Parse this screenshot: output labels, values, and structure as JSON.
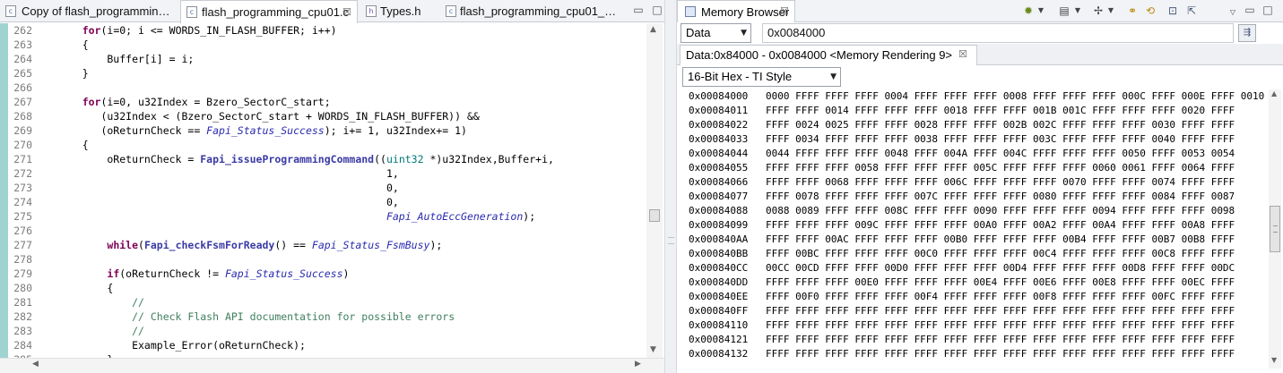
{
  "editor": {
    "tabs": [
      {
        "label": "Copy of flash_programmin…",
        "icon": "c-file-icon",
        "active": false
      },
      {
        "label": "flash_programming_cpu01.c",
        "icon": "c-file-icon",
        "active": true
      },
      {
        "label": "Types.h",
        "icon": "h-file-icon",
        "active": false
      },
      {
        "label": "flash_programming_cpu01_…",
        "icon": "c-file-icon",
        "active": false
      }
    ],
    "lines": [
      {
        "n": "262",
        "segs": [
          {
            "t": "    "
          },
          {
            "t": "for",
            "c": "kw"
          },
          {
            "t": "(i=0; i <= WORDS_IN_FLASH_BUFFER; i++)"
          }
        ]
      },
      {
        "n": "263",
        "segs": [
          {
            "t": "    {"
          }
        ]
      },
      {
        "n": "264",
        "segs": [
          {
            "t": "        Buffer[i] = i;"
          }
        ]
      },
      {
        "n": "265",
        "segs": [
          {
            "t": "    }"
          }
        ]
      },
      {
        "n": "266",
        "segs": []
      },
      {
        "n": "267",
        "segs": [
          {
            "t": "    "
          },
          {
            "t": "for",
            "c": "kw"
          },
          {
            "t": "(i=0, u32Index = Bzero_SectorC_start;"
          }
        ]
      },
      {
        "n": "268",
        "segs": [
          {
            "t": "       (u32Index < (Bzero_SectorC_start + WORDS_IN_FLASH_BUFFER)) &&"
          }
        ]
      },
      {
        "n": "269",
        "segs": [
          {
            "t": "       (oReturnCheck == "
          },
          {
            "t": "Fapi_Status_Success",
            "c": "it"
          },
          {
            "t": "); i+= 1, u32Index+= 1)"
          }
        ]
      },
      {
        "n": "270",
        "segs": [
          {
            "t": "    {"
          }
        ]
      },
      {
        "n": "271",
        "segs": [
          {
            "t": "        oReturnCheck = "
          },
          {
            "t": "Fapi_issueProgrammingCommand",
            "c": "fn"
          },
          {
            "t": "(("
          },
          {
            "t": "uint32",
            "c": "tp"
          },
          {
            "t": " *)u32Index,Buffer+i,"
          }
        ]
      },
      {
        "n": "272",
        "segs": [
          {
            "t": "                                                     1,"
          }
        ]
      },
      {
        "n": "273",
        "segs": [
          {
            "t": "                                                     0,"
          }
        ]
      },
      {
        "n": "274",
        "segs": [
          {
            "t": "                                                     0,"
          }
        ]
      },
      {
        "n": "275",
        "segs": [
          {
            "t": "                                                     "
          },
          {
            "t": "Fapi_AutoEccGeneration",
            "c": "it"
          },
          {
            "t": ");"
          }
        ]
      },
      {
        "n": "276",
        "segs": []
      },
      {
        "n": "277",
        "segs": [
          {
            "t": "        "
          },
          {
            "t": "while",
            "c": "kw"
          },
          {
            "t": "("
          },
          {
            "t": "Fapi_checkFsmForReady",
            "c": "fn"
          },
          {
            "t": "() == "
          },
          {
            "t": "Fapi_Status_FsmBusy",
            "c": "it"
          },
          {
            "t": ");"
          }
        ]
      },
      {
        "n": "278",
        "segs": []
      },
      {
        "n": "279",
        "segs": [
          {
            "t": "        "
          },
          {
            "t": "if",
            "c": "kw"
          },
          {
            "t": "(oReturnCheck != "
          },
          {
            "t": "Fapi_Status_Success",
            "c": "it"
          },
          {
            "t": ")"
          }
        ]
      },
      {
        "n": "280",
        "segs": [
          {
            "t": "        {"
          }
        ]
      },
      {
        "n": "281",
        "segs": [
          {
            "t": "            "
          },
          {
            "t": "//",
            "c": "cm"
          }
        ]
      },
      {
        "n": "282",
        "segs": [
          {
            "t": "            "
          },
          {
            "t": "// Check Flash API documentation for possible errors",
            "c": "cm"
          }
        ]
      },
      {
        "n": "283",
        "segs": [
          {
            "t": "            "
          },
          {
            "t": "//",
            "c": "cm"
          }
        ]
      },
      {
        "n": "284",
        "segs": [
          {
            "t": "            Example_Error(oReturnCheck);"
          }
        ]
      },
      {
        "n": "285",
        "segs": [
          {
            "t": "        }"
          }
        ]
      }
    ]
  },
  "memory_browser": {
    "title": "Memory Browser",
    "memory_space": "Data",
    "address_input": "0x0084000",
    "rendering_tab": "Data:0x84000 - 0x0084000 <Memory Rendering 9>",
    "format": "16-Bit Hex - TI Style",
    "rows": [
      {
        "addr": "0x00084000",
        "data": "0000 FFFF FFFF FFFF 0004 FFFF FFFF FFFF 0008 FFFF FFFF FFFF 000C FFFF 000E FFFF 0010"
      },
      {
        "addr": "0x00084011",
        "data": "FFFF FFFF 0014 FFFF FFFF FFFF 0018 FFFF FFFF 001B 001C FFFF FFFF FFFF 0020 FFFF"
      },
      {
        "addr": "0x00084022",
        "data": "FFFF 0024 0025 FFFF FFFF 0028 FFFF FFFF 002B 002C FFFF FFFF FFFF 0030 FFFF FFFF"
      },
      {
        "addr": "0x00084033",
        "data": "FFFF 0034 FFFF FFFF FFFF 0038 FFFF FFFF FFFF 003C FFFF FFFF FFFF 0040 FFFF FFFF"
      },
      {
        "addr": "0x00084044",
        "data": "0044 FFFF FFFF FFFF 0048 FFFF 004A FFFF 004C FFFF FFFF FFFF 0050 FFFF 0053 0054"
      },
      {
        "addr": "0x00084055",
        "data": "FFFF FFFF FFFF 0058 FFFF FFFF FFFF 005C FFFF FFFF FFFF 0060 0061 FFFF 0064 FFFF"
      },
      {
        "addr": "0x00084066",
        "data": "FFFF FFFF 0068 FFFF FFFF FFFF 006C FFFF FFFF FFFF 0070 FFFF FFFF 0074 FFFF FFFF"
      },
      {
        "addr": "0x00084077",
        "data": "FFFF 0078 FFFF FFFF FFFF 007C FFFF FFFF FFFF 0080 FFFF FFFF FFFF 0084 FFFF 0087"
      },
      {
        "addr": "0x00084088",
        "data": "0088 0089 FFFF FFFF 008C FFFF FFFF 0090 FFFF FFFF FFFF 0094 FFFF FFFF FFFF 0098"
      },
      {
        "addr": "0x00084099",
        "data": "FFFF FFFF FFFF 009C FFFF FFFF FFFF 00A0 FFFF 00A2 FFFF 00A4 FFFF FFFF 00A8 FFFF"
      },
      {
        "addr": "0x000840AA",
        "data": "FFFF FFFF 00AC FFFF FFFF FFFF 00B0 FFFF FFFF FFFF 00B4 FFFF FFFF 00B7 00B8 FFFF"
      },
      {
        "addr": "0x000840BB",
        "data": "FFFF 00BC FFFF FFFF FFFF 00C0 FFFF FFFF FFFF 00C4 FFFF FFFF FFFF 00C8 FFFF FFFF"
      },
      {
        "addr": "0x000840CC",
        "data": "00CC 00CD FFFF FFFF 00D0 FFFF FFFF FFFF 00D4 FFFF FFFF FFFF 00D8 FFFF FFFF 00DC"
      },
      {
        "addr": "0x000840DD",
        "data": "FFFF FFFF FFFF 00E0 FFFF FFFF FFFF 00E4 FFFF 00E6 FFFF 00E8 FFFF FFFF 00EC FFFF"
      },
      {
        "addr": "0x000840EE",
        "data": "FFFF 00F0 FFFF FFFF FFFF 00F4 FFFF FFFF FFFF 00F8 FFFF FFFF FFFF 00FC FFFF FFFF"
      },
      {
        "addr": "0x000840FF",
        "data": "FFFF FFFF FFFF FFFF FFFF FFFF FFFF FFFF FFFF FFFF FFFF FFFF FFFF FFFF FFFF FFFF"
      },
      {
        "addr": "0x00084110",
        "data": "FFFF FFFF FFFF FFFF FFFF FFFF FFFF FFFF FFFF FFFF FFFF FFFF FFFF FFFF FFFF FFFF"
      },
      {
        "addr": "0x00084121",
        "data": "FFFF FFFF FFFF FFFF FFFF FFFF FFFF FFFF FFFF FFFF FFFF FFFF FFFF FFFF FFFF FFFF"
      },
      {
        "addr": "0x00084132",
        "data": "FFFF FFFF FFFF FFFF FFFF FFFF FFFF FFFF FFFF FFFF FFFF FFFF FFFF FFFF FFFF FFFF"
      }
    ]
  },
  "colors": {
    "keyword": "#7f0055",
    "italic_constant": "#2a2ab0",
    "comment": "#3f7f5f",
    "gutter": "#9fd3d0"
  }
}
